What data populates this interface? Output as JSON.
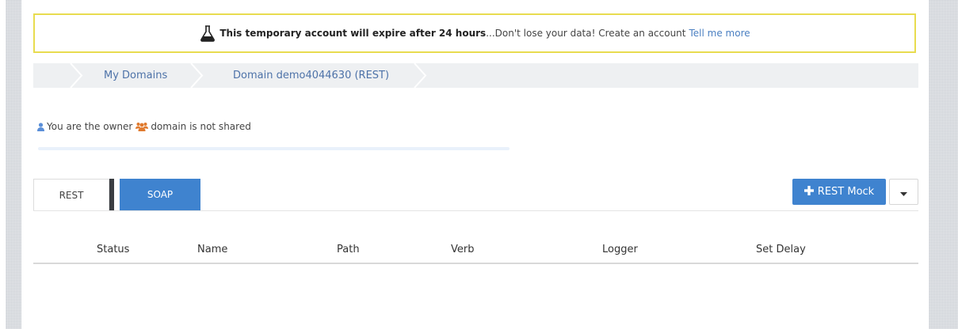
{
  "banner": {
    "icon": "flask-icon",
    "bold_text": "This temporary account will expire after 24 hours",
    "message": "...Don't lose your data! Create an account",
    "link": "Tell me more",
    "border_color": "#e8dc4f"
  },
  "breadcrumb": {
    "items": [
      {
        "label": "My Domains"
      },
      {
        "label": "Domain demo4044630 (REST)"
      }
    ]
  },
  "ownership": {
    "owner_icon": "user-icon",
    "owner_text": "You are the owner",
    "shared_icon": "users-icon",
    "shared_text": "domain is not shared"
  },
  "tabs": [
    {
      "label": "REST",
      "active": true
    },
    {
      "label": "SOAP",
      "active": false
    }
  ],
  "actions": {
    "add_mock_icon": "plus-icon",
    "add_mock_label": "REST Mock",
    "dropdown_icon": "caret-down-icon",
    "accent_color": "#3f83cf"
  },
  "table": {
    "columns": [
      "Status",
      "Name",
      "Path",
      "Verb",
      "Logger",
      "Set Delay"
    ],
    "rows": []
  }
}
